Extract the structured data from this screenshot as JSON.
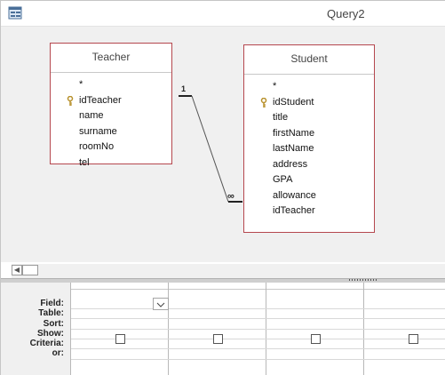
{
  "window": {
    "title": "Query2",
    "icon": "query-design-icon"
  },
  "tables": [
    {
      "name": "Teacher",
      "fields": [
        {
          "name": "*",
          "key": false
        },
        {
          "name": "idTeacher",
          "key": true
        },
        {
          "name": "name",
          "key": false
        },
        {
          "name": "surname",
          "key": false
        },
        {
          "name": "roomNo",
          "key": false
        },
        {
          "name": "tel",
          "key": false
        }
      ]
    },
    {
      "name": "Student",
      "fields": [
        {
          "name": "*",
          "key": false
        },
        {
          "name": "idStudent",
          "key": true
        },
        {
          "name": "title",
          "key": false
        },
        {
          "name": "firstName",
          "key": false
        },
        {
          "name": "lastName",
          "key": false
        },
        {
          "name": "address",
          "key": false
        },
        {
          "name": "GPA",
          "key": false
        },
        {
          "name": "allowance",
          "key": false
        },
        {
          "name": "idTeacher",
          "key": false
        }
      ]
    }
  ],
  "relationship": {
    "one_label": "1",
    "many_label": "∞"
  },
  "grid": {
    "row_labels": [
      "Field:",
      "Table:",
      "Sort:",
      "Show:",
      "Criteria:",
      "or:"
    ],
    "column_count": 4
  }
}
